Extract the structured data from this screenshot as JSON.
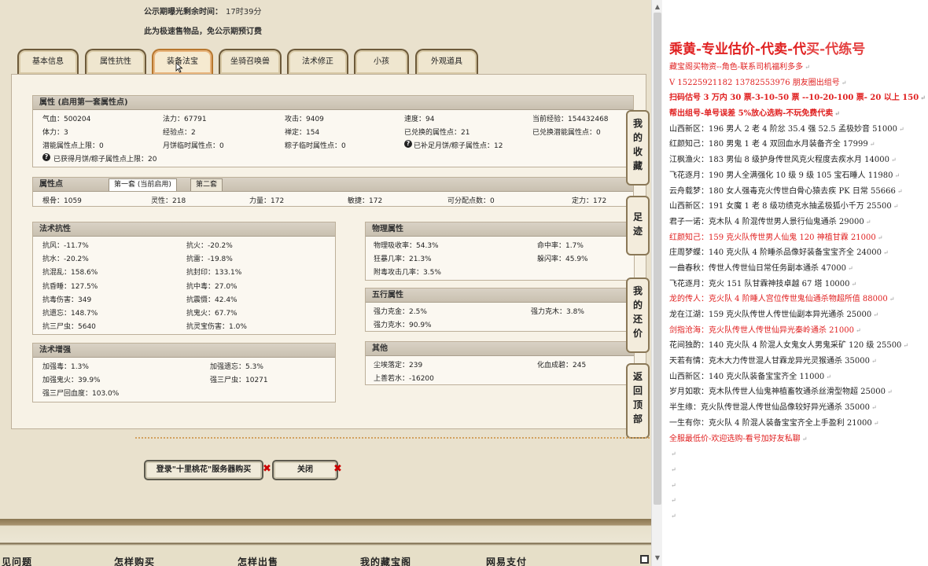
{
  "notice": {
    "countdown_label": "公示期曝光剩余时间：",
    "countdown_value": "17时39分",
    "fast_sale": "此为极速售物品，免公示期预订费"
  },
  "tabs": [
    "基本信息",
    "属性抗性",
    "装备法宝",
    "坐骑召唤兽",
    "法术修正",
    "小孩",
    "外观道具"
  ],
  "active_tab": "装备法宝",
  "attributes": {
    "title": "属性 (启用第一套属性点)",
    "rows": [
      [
        "气血：500204",
        "法力：67791",
        "攻击：9409",
        "速度：94",
        "当前经验：154432468"
      ],
      [
        "体力：3",
        "经验点：2",
        "禅定：154",
        "已兑换的属性点：21",
        "已兑换潜能属性点：0"
      ],
      [
        "潜能属性点上限：0",
        "月饼临时属性点：0",
        "粽子临时属性点：0",
        "已补足月饼/粽子属性点：12",
        ""
      ]
    ],
    "last": "已获得月饼/粽子属性点上限：20"
  },
  "points": {
    "title": "属性点",
    "subtabs": [
      "第一套 (当前启用)",
      "第二套"
    ],
    "values": [
      "根骨：1059",
      "灵性：218",
      "力量：172",
      "敏捷：172",
      "可分配点数：0",
      "定力：172"
    ]
  },
  "spell_resist": {
    "title": "法术抗性",
    "rows": [
      [
        "抗风：-11.7%",
        "抗火：-20.2%"
      ],
      [
        "抗水：-20.2%",
        "抗雷：-19.8%"
      ],
      [
        "抗混乱：158.6%",
        "抗封印：133.1%"
      ],
      [
        "抗昏睡：127.5%",
        "抗中毒：27.0%"
      ],
      [
        "抗毒伤害：349",
        "抗震慑：42.4%"
      ],
      [
        "抗遗忘：148.7%",
        "抗鬼火：67.7%"
      ],
      [
        "抗三尸虫：5640",
        "抗灵宝伤害：1.0%"
      ]
    ]
  },
  "spell_boost": {
    "title": "法术增强",
    "rows": [
      [
        "加强毒：1.3%",
        "加强遗忘：5.3%"
      ],
      [
        "加强鬼火：39.9%",
        "强三尸虫：10271"
      ],
      [
        "强三尸回血度：103.0%",
        ""
      ]
    ]
  },
  "physical": {
    "title": "物理属性",
    "rows": [
      [
        "物理吸收率：54.3%",
        "命中率：1.7%"
      ],
      [
        "狂暴几率：21.3%",
        "躲闪率：45.9%"
      ],
      [
        "附毒攻击几率：3.5%",
        ""
      ]
    ]
  },
  "five_elements": {
    "title": "五行属性",
    "rows": [
      [
        "强力克金：2.5%",
        "强力克木：3.8%"
      ],
      [
        "强力克水：90.9%",
        ""
      ]
    ]
  },
  "other": {
    "title": "其他",
    "rows": [
      [
        "尘埃落定：239",
        "化血成碧：245"
      ],
      [
        "上善若水：-16200",
        ""
      ]
    ]
  },
  "side_buttons": [
    "我的收藏",
    "足迹",
    "我的还价",
    "返回顶部"
  ],
  "buttons": {
    "login_buy": "登录\"十里桃花\"服务器购买",
    "close": "关闭"
  },
  "footer_links": [
    "见问题",
    "怎样购买",
    "怎样出售",
    "我的藏宝阁",
    "网易支付"
  ],
  "icons": {
    "info": "info-icon",
    "close_x": "close-x-icon"
  },
  "right_panel": {
    "title": "乘黄-专业估价-代卖-代",
    "title_tail": "买-代练号",
    "lines": [
      {
        "t": "藏宝阁买物资--角色-联系司机福利多多",
        "s": "red"
      },
      {
        "t": "V 15225921182    13782553976 朋友圈出组号",
        "s": "red"
      },
      {
        "t": "扫码估号 3 万内 30 票-3-10-50 票  --10-20-100 票- 20 以上 150",
        "s": "bold"
      },
      {
        "t": "帮出组号-单号误差 5%放心选购-不玩免费代卖",
        "s": "bold"
      },
      {
        "t": "山西新区：196 男人 2 老 4 阶忿 35.4 强 52.5 孟极妙音 51000",
        "s": ""
      },
      {
        "t": "红颜知己：180 男鬼 1 老 4 双回血水月装备齐全 17999",
        "s": ""
      },
      {
        "t": "江枫渔火：183 男仙 8 级护身传世风克火程度去疾水月 14000",
        "s": ""
      },
      {
        "t": "飞花逐月：190 男人全满强化 10 级 9 级 105 宝石睡人 11980",
        "s": ""
      },
      {
        "t": "云舟载梦：180 女人强毒克火传世白骨心猿去疾 PK 日常 55666",
        "s": ""
      },
      {
        "t": "山西新区：191 女魔 1 老 8 级功绩克水抽孟极狐小千万 25500",
        "s": ""
      },
      {
        "t": "君子一诺：克木队 4 阶混传世男人景行仙鬼通杀 29000",
        "s": ""
      },
      {
        "t": "红颜知己：159 克火队传世男人仙鬼  120 神植甘霖 21000",
        "s": "red"
      },
      {
        "t": "庄周梦蝶：140 克火队 4 阶睡杀品像好装备宝宝齐全 24000",
        "s": ""
      },
      {
        "t": "一曲春秋：传世人传世仙日常任务副本通杀 47000",
        "s": ""
      },
      {
        "t": "飞花逐月：克火 151 队甘霖神技卓越 67 塔 10000",
        "s": ""
      },
      {
        "t": "龙的传人：克火队 4 阶睡人宫位传世鬼仙通杀物超所值 88000",
        "s": "red"
      },
      {
        "t": "龙在江湖：159 克火队传世人传世仙副本异光通杀 25000",
        "s": ""
      },
      {
        "t": "剑指沧海：克火队传世人传世仙异光秦岭通杀 21000",
        "s": "red"
      },
      {
        "t": "花间独酌：140 克火队 4 阶混人女鬼女人男鬼采矿  120 级 25500",
        "s": ""
      },
      {
        "t": "天若有情：克木大力传世混人甘霖龙异光灵猴通杀 35000",
        "s": ""
      },
      {
        "t": "山西新区：140 克火队装备宝宝齐全 11000",
        "s": ""
      },
      {
        "t": "岁月如歌：克木队传世人仙鬼神植畜牧通杀丝滑型物超 25000",
        "s": ""
      },
      {
        "t": "半生缘：克火队传世混人传世仙品像较好异光通杀 35000",
        "s": ""
      },
      {
        "t": "一生有你：克火队 4 阶混人装备宝宝齐全上手盈利 21000",
        "s": ""
      },
      {
        "t": "全服最低价-欢迎选购-看号加好友私聊",
        "s": "red"
      },
      {
        "t": "",
        "s": ""
      },
      {
        "t": "",
        "s": ""
      },
      {
        "t": "",
        "s": ""
      },
      {
        "t": "",
        "s": ""
      },
      {
        "t": "",
        "s": ""
      }
    ],
    "para_mark": "↵"
  }
}
